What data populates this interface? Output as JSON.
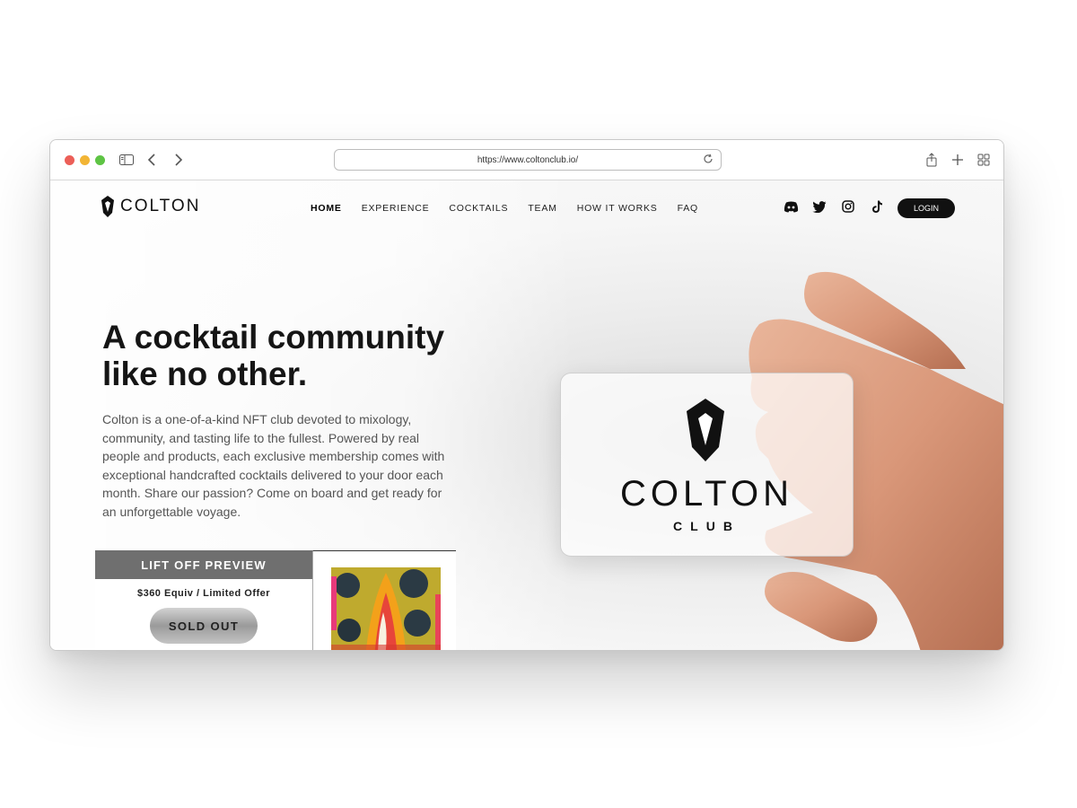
{
  "browser": {
    "url": "https://www.coltonclub.io/"
  },
  "brand": {
    "name": "COLTON"
  },
  "nav": {
    "items": [
      "HOME",
      "EXPERIENCE",
      "COCKTAILS",
      "TEAM",
      "HOW IT WORKS",
      "FAQ"
    ],
    "active": "HOME"
  },
  "social": [
    "discord-icon",
    "twitter-icon",
    "instagram-icon",
    "tiktok-icon"
  ],
  "login_label": "LOGIN",
  "hero": {
    "title_line1": "A cocktail community",
    "title_line2": "like no other.",
    "description": "Colton is a one-of-a-kind NFT club devoted to mixology, community, and tasting life to the fullest. Powered by real people and products, each exclusive membership comes with exceptional handcrafted cocktails delivered to your door each month. Share our passion?  Come on board and get ready for an unforgettable voyage."
  },
  "offer": {
    "heading": "LIFT OFF PREVIEW",
    "price": "$360 Equiv / Limited Offer",
    "button_label": "SOLD OUT"
  },
  "card": {
    "title": "COLTON",
    "subtitle": "CLUB"
  },
  "colors": {
    "accent": "#111111",
    "offer_header": "#6f6f6f"
  }
}
